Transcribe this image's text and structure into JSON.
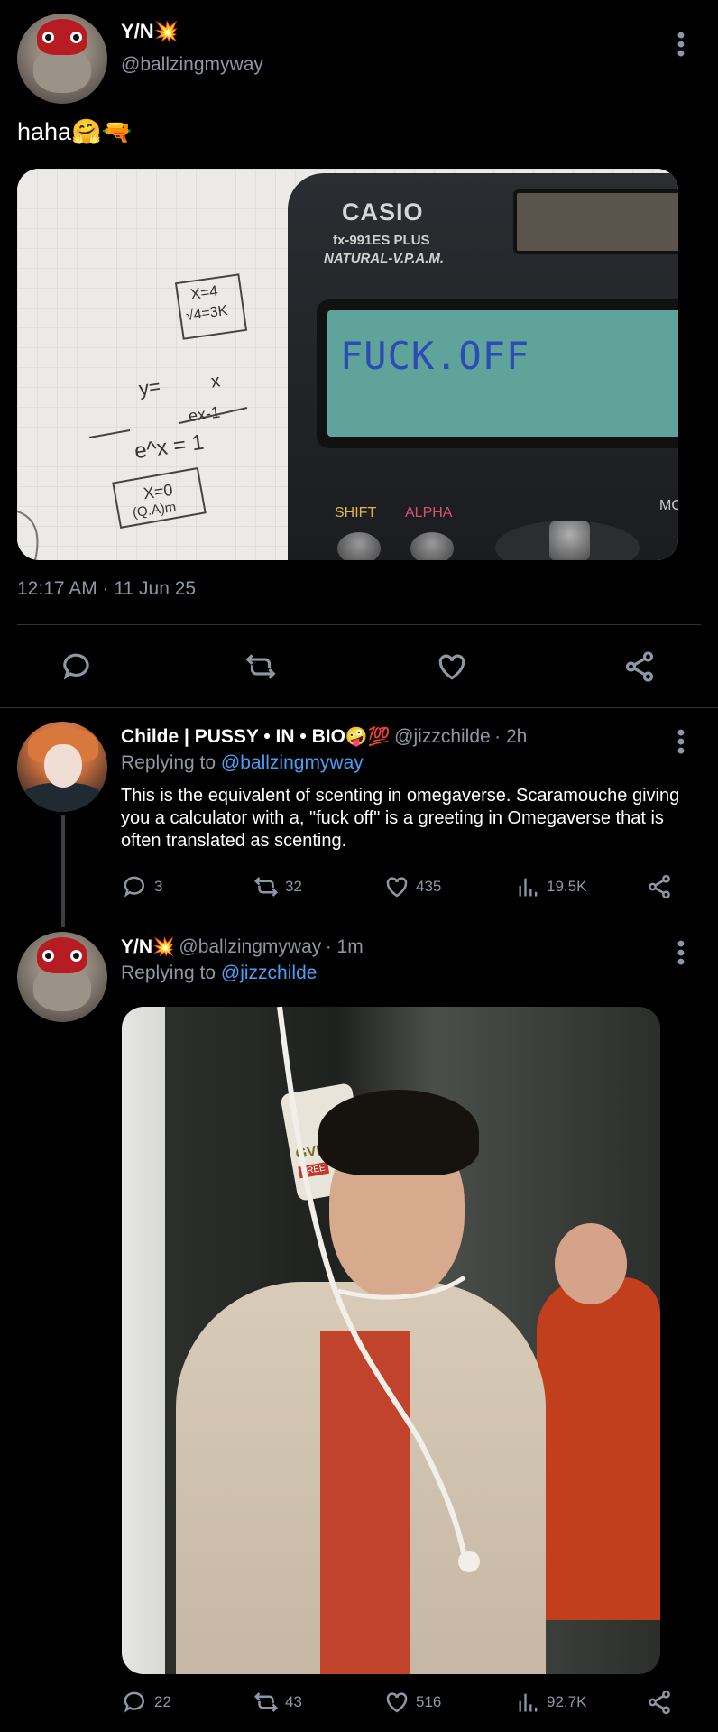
{
  "main_tweet": {
    "author_name": "Y/N",
    "author_emoji": "💥",
    "handle": "@ballzingmyway",
    "text": "haha",
    "text_emojis": "🤗🔫",
    "timestamp": "12:17 AM · 11 Jun 25",
    "calculator": {
      "brand": "CASIO",
      "model": "fx-991ES PLUS",
      "series": "NATURAL-V.P.A.M.",
      "display": "FUCK.OFF",
      "shift": "SHIFT",
      "alpha": "ALPHA",
      "mode": "MOD"
    },
    "notes": {
      "n1": "X=4",
      "n2": "√4=3K",
      "n3": "y=",
      "n4": "x",
      "n5": "ex-1",
      "n6": "e^x = 1",
      "n7": "X=0",
      "n8": "(Q.A)m"
    }
  },
  "reply1": {
    "author_name": "Childe | PUSSY • IN • BIO",
    "author_emoji": "🤪💯",
    "handle": "@jizzchilde",
    "time": "· 2h",
    "replying_to_prefix": "Replying to",
    "replying_to": "@ballzingmyway",
    "text": "This is the equivalent of scenting in omegaverse. Scaramouche giving you a calculator with a, \"fuck off\" is a greeting in Omegaverse that is often translated as scenting.",
    "replies": "3",
    "retweets": "32",
    "likes": "435",
    "views": "19.5K"
  },
  "reply2": {
    "author_name": "Y/N",
    "author_emoji": "💥",
    "handle": "@ballzingmyway",
    "time": "· 1m",
    "replying_to_prefix": "Replying to",
    "replying_to": "@jizzchilde",
    "replies": "22",
    "retweets": "43",
    "likes": "516",
    "views": "92.7K",
    "photo_label": "GVIL",
    "photo_label2": "FREE"
  },
  "colors": {
    "background": "#000000",
    "secondary_text": "#8b98a5",
    "link": "#4a9ff5",
    "calculator_screen": "#5fa39a"
  },
  "icons": [
    "kebab-icon",
    "reply-icon",
    "retweet-icon",
    "like-icon",
    "share-icon",
    "views-icon"
  ]
}
